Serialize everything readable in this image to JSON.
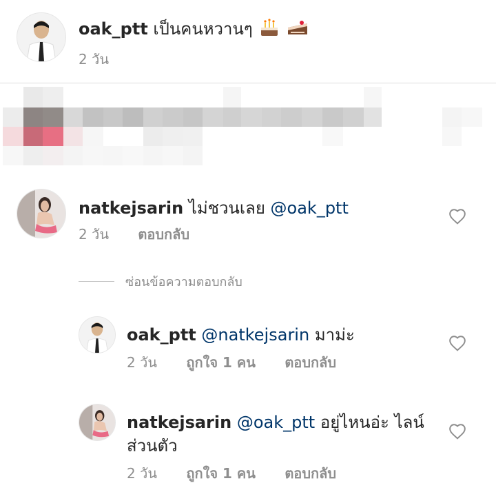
{
  "post": {
    "username": "oak_ptt",
    "caption": "เป็นคนหวานๆ",
    "emoji": [
      "birthday-cake",
      "cake-slice"
    ],
    "time": "2 วัน"
  },
  "comments": [
    {
      "username": "natkejsarin",
      "text": "ไม่ชวนเลย",
      "mention": "@oak_ptt",
      "time": "2 วัน",
      "reply_label": "ตอบกลับ"
    }
  ],
  "hide_replies_label": "ซ่อนข้อความตอบกลับ",
  "replies": [
    {
      "username": "oak_ptt",
      "mention": "@natkejsarin",
      "text": "มาม่ะ",
      "time": "2 วัน",
      "likes": "ถูกใจ 1 คน",
      "reply_label": "ตอบกลับ"
    },
    {
      "username": "natkejsarin",
      "mention": "@oak_ptt",
      "text": "อยู่ไหนอ่ะ ไลน์",
      "text_line2": "ส่วนตัว",
      "time": "2 วัน",
      "likes": "ถูกใจ 1 คน",
      "reply_label": "ตอบกลับ"
    }
  ],
  "colors": {
    "text": "#262626",
    "mention": "#003569",
    "meta": "#8e8e8e",
    "divider": "#dbdbdb"
  }
}
